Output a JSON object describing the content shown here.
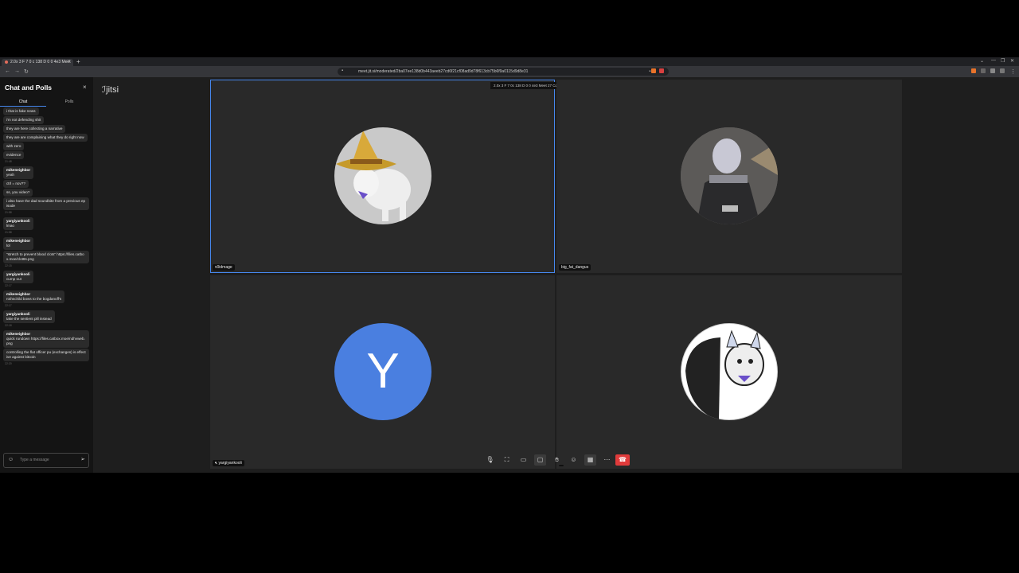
{
  "browser": {
    "tab_title": "2.0x 3 F 7 0 c 138 D 0 0 4e3 Meet",
    "new_tab": "+",
    "url": "meet.jit.si/moderated/2ba07ee138d0b443aeeb27cd6f21cf08ad9d78f613cb75b6f9a0115d9d8e31",
    "window_controls": [
      "⌄",
      "—",
      "❐",
      "✕"
    ]
  },
  "chat": {
    "title": "Chat and Polls",
    "close": "×",
    "tabs": [
      "Chat",
      "Polls"
    ],
    "entries": [
      {
        "type": "msg",
        "text": "i that is fake news"
      },
      {
        "type": "msg",
        "text": "i'm not defending shit"
      },
      {
        "type": "msg",
        "text": "they are here collecting a narrative"
      },
      {
        "type": "msg",
        "text": "they are are complaining what they do right now"
      },
      {
        "type": "msg",
        "text": "with zero"
      },
      {
        "type": "msg",
        "text": "evidence"
      },
      {
        "type": "ts",
        "text": "21:48"
      },
      {
        "type": "msg",
        "from": "mikeneighbor",
        "text": "yeah"
      },
      {
        "type": "msg",
        "text": "ctrl = nov??"
      },
      {
        "type": "msg",
        "text": "ss, you video?"
      },
      {
        "type": "msg",
        "text": "i also have the dad soundbite from a previous episode"
      },
      {
        "type": "ts",
        "text": "21:58"
      },
      {
        "type": "msg",
        "from": "yargiyankooli",
        "text": "lmao"
      },
      {
        "type": "ts",
        "text": "21:58"
      },
      {
        "type": "msg",
        "from": "mikeneighbor",
        "text": "lol"
      },
      {
        "type": "msg",
        "text": "\"stretch to prevent blood clots\" https://files.catbox.moe/clot8s.png"
      },
      {
        "type": "ts",
        "text": "22:15"
      },
      {
        "type": "msg",
        "from": "yargiyankooli",
        "text": "cump out"
      },
      {
        "type": "ts",
        "text": "22:17"
      },
      {
        "type": "msg",
        "from": "mikeneighbor",
        "text": "rothschild bows to the bogdanoff's"
      },
      {
        "type": "ts",
        "text": "22:17"
      },
      {
        "type": "msg",
        "from": "yargiyankooli",
        "text": "take the sentient pill instead"
      },
      {
        "type": "ts",
        "text": "22:18"
      },
      {
        "type": "msg",
        "from": "mikeneighbor",
        "text": "quick rundown https://files.catbox.moe/ndhvweb.png"
      },
      {
        "type": "msg",
        "text": "controlling the flat officer pu (exchanges) is effective against bitcoin"
      },
      {
        "type": "ts",
        "text": "22:20"
      }
    ],
    "input_placeholder": "Type a message"
  },
  "logo": "jitsi",
  "stats_bar": {
    "room": "2.0x 3 F 7 0c 138 D 0 0 4e3 Meet 27 Cd 0f...",
    "timer": "2:41:44"
  },
  "participants": [
    {
      "name": "v0idmage",
      "avatar": "goat-wizard-avatar",
      "active": true
    },
    {
      "name": "big_fat_dangus",
      "avatar": "warrior-avatar",
      "active": false
    },
    {
      "name": "yargiyankooli",
      "avatar": "letter-avatar",
      "letter": "Y",
      "color": "#4a7fe0",
      "active": false
    },
    {
      "name": "",
      "avatar": "goat-mascot-avatar",
      "active": false
    }
  ],
  "toolbar": {
    "items": [
      "microphone-icon",
      "camera-icon",
      "screen-share-icon",
      "chat-icon",
      "raise-hand-icon",
      "reactions-icon",
      "tile-view-icon",
      "more-icon",
      "hangup-icon"
    ]
  },
  "colors": {
    "accent": "#4687ed",
    "hangup": "#e03b3b"
  }
}
